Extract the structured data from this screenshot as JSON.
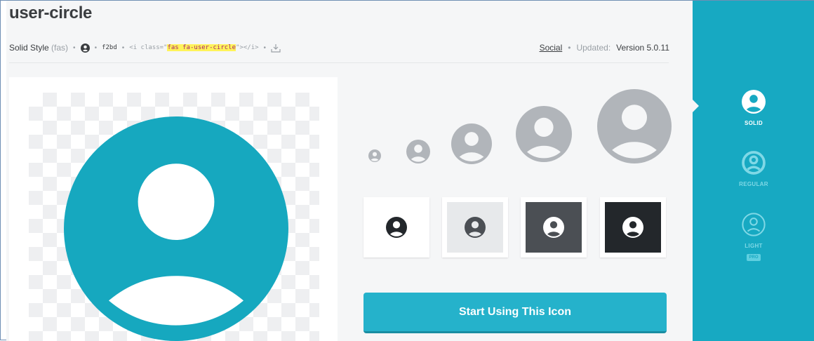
{
  "icon": {
    "name": "user-circle",
    "style_label": "Solid Style",
    "style_prefix": "(fas)",
    "unicode": "f2bd",
    "html_open": "<i class=\"",
    "html_class": "fas fa-user-circle",
    "html_close": "\"></i>",
    "category": "Social",
    "updated_label": "Updated:",
    "version": "Version 5.0.11"
  },
  "actions": {
    "start_label": "Start Using This Icon"
  },
  "styles": [
    {
      "label": "SOLID",
      "active": true
    },
    {
      "label": "REGULAR",
      "active": false
    },
    {
      "label": "LIGHT",
      "active": false,
      "badge": "PRO"
    }
  ],
  "colors": {
    "accent": "#17a9c2",
    "cta": "#25b2cb",
    "preview_icon": "#16a8bf",
    "size_icon": "#b1b5ba",
    "highlight": "#fff35a"
  }
}
